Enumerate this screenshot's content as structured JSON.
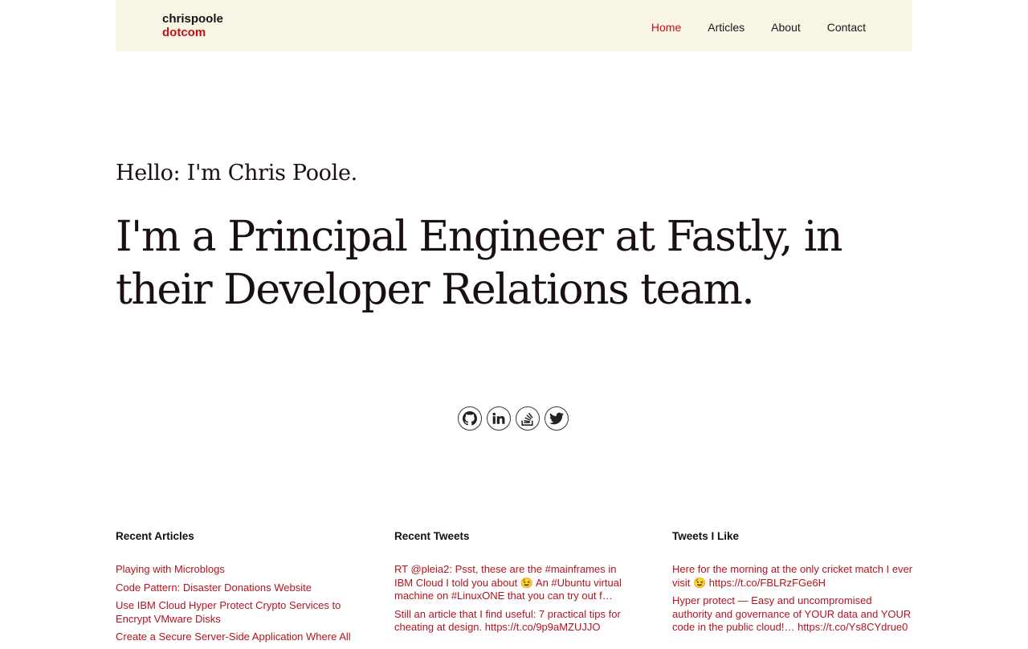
{
  "logo": {
    "line1": "chrispoole",
    "line2": "dotcom"
  },
  "nav": [
    {
      "label": "Home",
      "active": true
    },
    {
      "label": "Articles",
      "active": false
    },
    {
      "label": "About",
      "active": false
    },
    {
      "label": "Contact",
      "active": false
    }
  ],
  "hero": {
    "hello": "Hello: I'm Chris Poole.",
    "headline": "I'm a Principal Engineer at Fastly, in their Developer Relations team."
  },
  "social": [
    "github-icon",
    "linkedin-icon",
    "stackoverflow-icon",
    "twitter-icon"
  ],
  "sections": {
    "articles": {
      "title": "Recent Articles",
      "items": [
        "Playing with Microblogs",
        "Code Pattern: Disaster Donations Website",
        "Use IBM Cloud Hyper Protect Crypto Services to Encrypt VMware Disks",
        "Create a Secure Server-Side Application Where All"
      ]
    },
    "tweets": {
      "title": "Recent Tweets",
      "items": [
        "RT @pleia2: Psst, these are the #mainframes in IBM Cloud I told you about 😉 An #Ubuntu virtual machine on #LinuxONE that you can try out f…",
        "Still an article that I find useful: 7 practical tips for cheating at design. https://t.co/9p9aMZUJJO"
      ]
    },
    "liked": {
      "title": "Tweets I Like",
      "items": [
        "Here for the morning at the only cricket match I ever visit 😉 https://t.co/FBLRzFGe6H",
        "Hyper protect — Easy and uncompromised authority and governance of YOUR data and YOUR code in the public cloud!… https://t.co/Ys8CYdrue0"
      ]
    }
  },
  "colors": {
    "accent": "#c0101a",
    "header_bg": "#f9f5e4"
  }
}
